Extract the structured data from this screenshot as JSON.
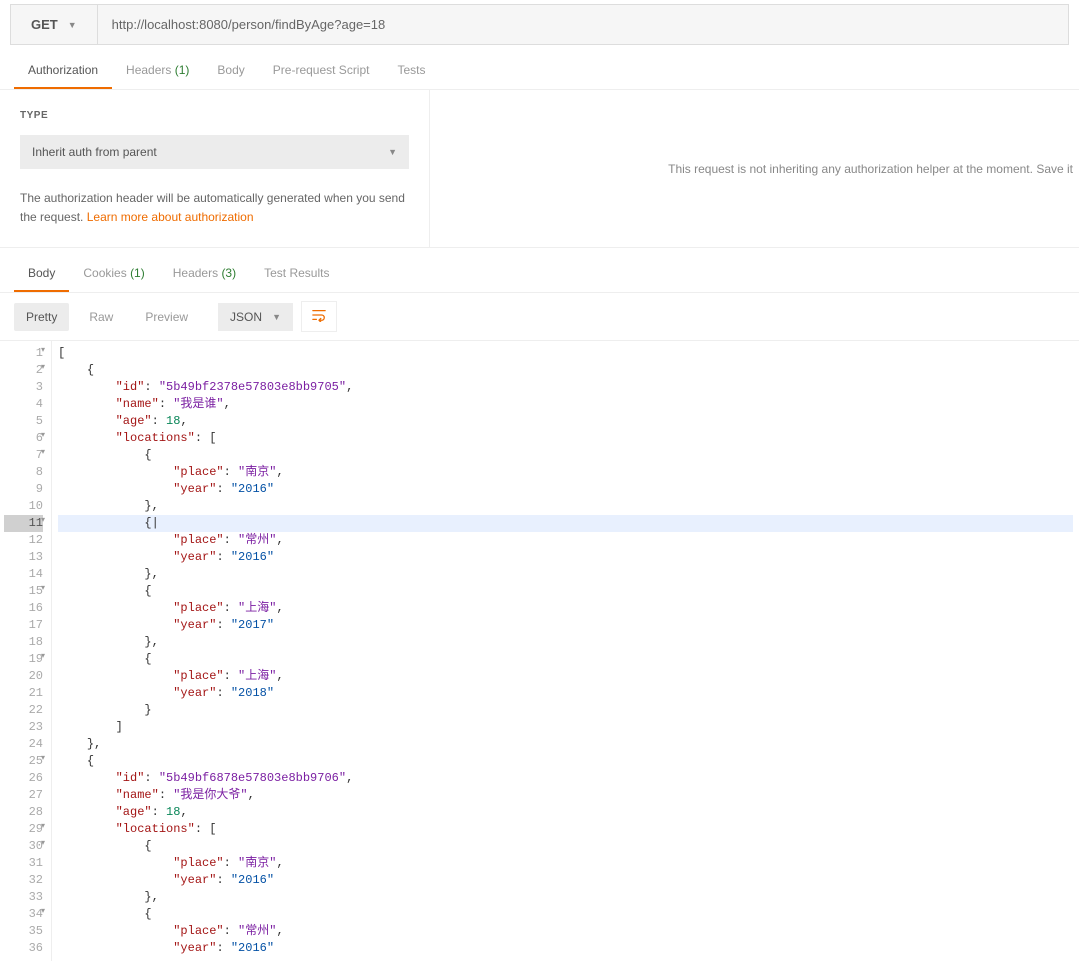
{
  "request": {
    "method": "GET",
    "url": "http://localhost:8080/person/findByAge?age=18"
  },
  "reqTabs": {
    "authorization": "Authorization",
    "headers": "Headers",
    "headersCount": "(1)",
    "body": "Body",
    "prerequest": "Pre-request Script",
    "tests": "Tests"
  },
  "auth": {
    "typeLabel": "TYPE",
    "selectValue": "Inherit auth from parent",
    "descPrefix": "The authorization header will be automatically generated when you send the request. ",
    "learnMore": "Learn more about authorization",
    "rightMsg": "This request is not inheriting any authorization helper at the moment. Save it"
  },
  "respTabs": {
    "body": "Body",
    "cookies": "Cookies",
    "cookiesCount": "(1)",
    "headers": "Headers",
    "headersCount": "(3)",
    "testResults": "Test Results"
  },
  "toolbar": {
    "pretty": "Pretty",
    "raw": "Raw",
    "preview": "Preview",
    "format": "JSON"
  },
  "responseBody": [
    {
      "n": 1,
      "fold": true,
      "ind": 0,
      "tokens": [
        {
          "t": "pun",
          "v": "["
        }
      ]
    },
    {
      "n": 2,
      "fold": true,
      "ind": 1,
      "tokens": [
        {
          "t": "pun",
          "v": "{"
        }
      ]
    },
    {
      "n": 3,
      "fold": false,
      "ind": 2,
      "tokens": [
        {
          "t": "key",
          "v": "\"id\""
        },
        {
          "t": "pun",
          "v": ": "
        },
        {
          "t": "idv",
          "v": "\"5b49bf2378e57803e8bb9705\""
        },
        {
          "t": "pun",
          "v": ","
        }
      ]
    },
    {
      "n": 4,
      "fold": false,
      "ind": 2,
      "tokens": [
        {
          "t": "key",
          "v": "\"name\""
        },
        {
          "t": "pun",
          "v": ": "
        },
        {
          "t": "strcn",
          "v": "\"我是谁\""
        },
        {
          "t": "pun",
          "v": ","
        }
      ]
    },
    {
      "n": 5,
      "fold": false,
      "ind": 2,
      "tokens": [
        {
          "t": "key",
          "v": "\"age\""
        },
        {
          "t": "pun",
          "v": ": "
        },
        {
          "t": "num",
          "v": "18"
        },
        {
          "t": "pun",
          "v": ","
        }
      ]
    },
    {
      "n": 6,
      "fold": true,
      "ind": 2,
      "tokens": [
        {
          "t": "key",
          "v": "\"locations\""
        },
        {
          "t": "pun",
          "v": ": ["
        }
      ]
    },
    {
      "n": 7,
      "fold": true,
      "ind": 3,
      "tokens": [
        {
          "t": "pun",
          "v": "{"
        }
      ]
    },
    {
      "n": 8,
      "fold": false,
      "ind": 4,
      "tokens": [
        {
          "t": "key",
          "v": "\"place\""
        },
        {
          "t": "pun",
          "v": ": "
        },
        {
          "t": "strcn",
          "v": "\"南京\""
        },
        {
          "t": "pun",
          "v": ","
        }
      ]
    },
    {
      "n": 9,
      "fold": false,
      "ind": 4,
      "tokens": [
        {
          "t": "key",
          "v": "\"year\""
        },
        {
          "t": "pun",
          "v": ": "
        },
        {
          "t": "str",
          "v": "\"2016\""
        }
      ]
    },
    {
      "n": 10,
      "fold": false,
      "ind": 3,
      "tokens": [
        {
          "t": "pun",
          "v": "},"
        }
      ]
    },
    {
      "n": 11,
      "fold": true,
      "ind": 3,
      "hl": true,
      "tokens": [
        {
          "t": "pun",
          "v": "{|"
        }
      ]
    },
    {
      "n": 12,
      "fold": false,
      "ind": 4,
      "tokens": [
        {
          "t": "key",
          "v": "\"place\""
        },
        {
          "t": "pun",
          "v": ": "
        },
        {
          "t": "strcn",
          "v": "\"常州\""
        },
        {
          "t": "pun",
          "v": ","
        }
      ]
    },
    {
      "n": 13,
      "fold": false,
      "ind": 4,
      "tokens": [
        {
          "t": "key",
          "v": "\"year\""
        },
        {
          "t": "pun",
          "v": ": "
        },
        {
          "t": "str",
          "v": "\"2016\""
        }
      ]
    },
    {
      "n": 14,
      "fold": false,
      "ind": 3,
      "tokens": [
        {
          "t": "pun",
          "v": "},"
        }
      ]
    },
    {
      "n": 15,
      "fold": true,
      "ind": 3,
      "tokens": [
        {
          "t": "pun",
          "v": "{"
        }
      ]
    },
    {
      "n": 16,
      "fold": false,
      "ind": 4,
      "tokens": [
        {
          "t": "key",
          "v": "\"place\""
        },
        {
          "t": "pun",
          "v": ": "
        },
        {
          "t": "strcn",
          "v": "\"上海\""
        },
        {
          "t": "pun",
          "v": ","
        }
      ]
    },
    {
      "n": 17,
      "fold": false,
      "ind": 4,
      "tokens": [
        {
          "t": "key",
          "v": "\"year\""
        },
        {
          "t": "pun",
          "v": ": "
        },
        {
          "t": "str",
          "v": "\"2017\""
        }
      ]
    },
    {
      "n": 18,
      "fold": false,
      "ind": 3,
      "tokens": [
        {
          "t": "pun",
          "v": "},"
        }
      ]
    },
    {
      "n": 19,
      "fold": true,
      "ind": 3,
      "tokens": [
        {
          "t": "pun",
          "v": "{"
        }
      ]
    },
    {
      "n": 20,
      "fold": false,
      "ind": 4,
      "tokens": [
        {
          "t": "key",
          "v": "\"place\""
        },
        {
          "t": "pun",
          "v": ": "
        },
        {
          "t": "strcn",
          "v": "\"上海\""
        },
        {
          "t": "pun",
          "v": ","
        }
      ]
    },
    {
      "n": 21,
      "fold": false,
      "ind": 4,
      "tokens": [
        {
          "t": "key",
          "v": "\"year\""
        },
        {
          "t": "pun",
          "v": ": "
        },
        {
          "t": "str",
          "v": "\"2018\""
        }
      ]
    },
    {
      "n": 22,
      "fold": false,
      "ind": 3,
      "tokens": [
        {
          "t": "pun",
          "v": "}"
        }
      ]
    },
    {
      "n": 23,
      "fold": false,
      "ind": 2,
      "tokens": [
        {
          "t": "pun",
          "v": "]"
        }
      ]
    },
    {
      "n": 24,
      "fold": false,
      "ind": 1,
      "tokens": [
        {
          "t": "pun",
          "v": "},"
        }
      ]
    },
    {
      "n": 25,
      "fold": true,
      "ind": 1,
      "tokens": [
        {
          "t": "pun",
          "v": "{"
        }
      ]
    },
    {
      "n": 26,
      "fold": false,
      "ind": 2,
      "tokens": [
        {
          "t": "key",
          "v": "\"id\""
        },
        {
          "t": "pun",
          "v": ": "
        },
        {
          "t": "idv",
          "v": "\"5b49bf6878e57803e8bb9706\""
        },
        {
          "t": "pun",
          "v": ","
        }
      ]
    },
    {
      "n": 27,
      "fold": false,
      "ind": 2,
      "tokens": [
        {
          "t": "key",
          "v": "\"name\""
        },
        {
          "t": "pun",
          "v": ": "
        },
        {
          "t": "strcn",
          "v": "\"我是你大爷\""
        },
        {
          "t": "pun",
          "v": ","
        }
      ]
    },
    {
      "n": 28,
      "fold": false,
      "ind": 2,
      "tokens": [
        {
          "t": "key",
          "v": "\"age\""
        },
        {
          "t": "pun",
          "v": ": "
        },
        {
          "t": "num",
          "v": "18"
        },
        {
          "t": "pun",
          "v": ","
        }
      ]
    },
    {
      "n": 29,
      "fold": true,
      "ind": 2,
      "tokens": [
        {
          "t": "key",
          "v": "\"locations\""
        },
        {
          "t": "pun",
          "v": ": ["
        }
      ]
    },
    {
      "n": 30,
      "fold": true,
      "ind": 3,
      "tokens": [
        {
          "t": "pun",
          "v": "{"
        }
      ]
    },
    {
      "n": 31,
      "fold": false,
      "ind": 4,
      "tokens": [
        {
          "t": "key",
          "v": "\"place\""
        },
        {
          "t": "pun",
          "v": ": "
        },
        {
          "t": "strcn",
          "v": "\"南京\""
        },
        {
          "t": "pun",
          "v": ","
        }
      ]
    },
    {
      "n": 32,
      "fold": false,
      "ind": 4,
      "tokens": [
        {
          "t": "key",
          "v": "\"year\""
        },
        {
          "t": "pun",
          "v": ": "
        },
        {
          "t": "str",
          "v": "\"2016\""
        }
      ]
    },
    {
      "n": 33,
      "fold": false,
      "ind": 3,
      "tokens": [
        {
          "t": "pun",
          "v": "},"
        }
      ]
    },
    {
      "n": 34,
      "fold": true,
      "ind": 3,
      "tokens": [
        {
          "t": "pun",
          "v": "{"
        }
      ]
    },
    {
      "n": 35,
      "fold": false,
      "ind": 4,
      "tokens": [
        {
          "t": "key",
          "v": "\"place\""
        },
        {
          "t": "pun",
          "v": ": "
        },
        {
          "t": "strcn",
          "v": "\"常州\""
        },
        {
          "t": "pun",
          "v": ","
        }
      ]
    },
    {
      "n": 36,
      "fold": false,
      "ind": 4,
      "tokens": [
        {
          "t": "key",
          "v": "\"year\""
        },
        {
          "t": "pun",
          "v": ": "
        },
        {
          "t": "str",
          "v": "\"2016\""
        }
      ]
    }
  ]
}
